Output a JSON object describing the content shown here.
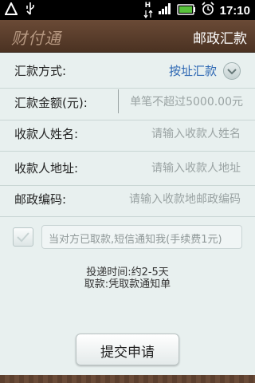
{
  "status_bar": {
    "time": "17:10",
    "net_label": "H",
    "icons": [
      "warning-icon",
      "usb-icon",
      "data-arrows-icon",
      "signal-icon",
      "battery-icon",
      "alarm-icon"
    ]
  },
  "header": {
    "logo": "财付通",
    "title": "邮政汇款"
  },
  "form": {
    "method": {
      "label": "汇款方式:",
      "value": "按址汇款"
    },
    "amount": {
      "label": "汇款金额(元):",
      "placeholder": "单笔不超过5000.00元"
    },
    "name": {
      "label": "收款人姓名:",
      "placeholder": "请输入收款人姓名"
    },
    "address": {
      "label": "收款人地址:",
      "placeholder": "请输入收款人地址"
    },
    "postcode": {
      "label": "邮政编码:",
      "placeholder": "请输入收款地邮政编码"
    }
  },
  "notify": {
    "text": "当对方已取款,短信通知我(手续费1元)"
  },
  "info": {
    "line1": "投递时间:约2-5天",
    "line2": "取款:凭取款通知单"
  },
  "submit": {
    "label": "提交申请"
  },
  "colors": {
    "header": "#5a3c2b",
    "accent": "#2d67b3",
    "background": "#e8f0ef"
  }
}
